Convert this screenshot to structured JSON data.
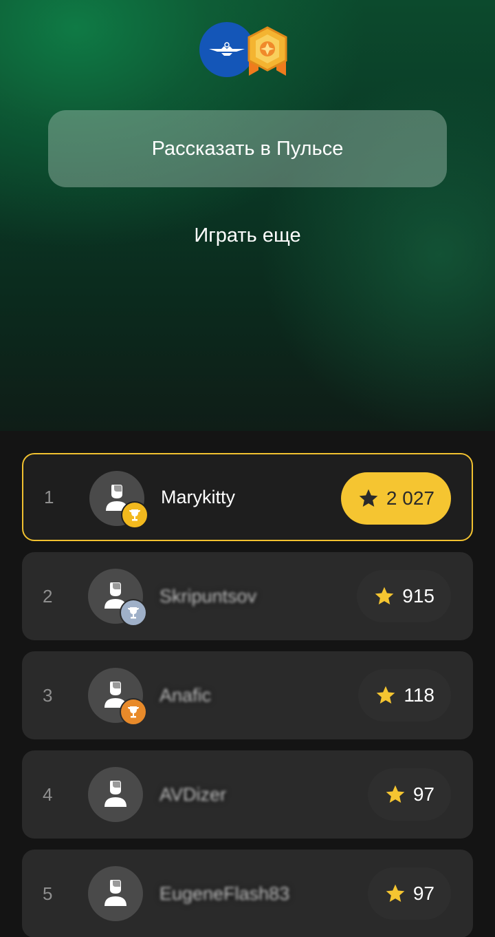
{
  "header": {
    "share_label": "Рассказать в Пульсе",
    "play_again_label": "Играть еще"
  },
  "colors": {
    "accent_gold": "#f5c531",
    "trophy_gold": "#f2b91e",
    "trophy_silver": "#9fb0c8",
    "trophy_bronze": "#e88a2a",
    "brand_blue": "#1456b8"
  },
  "leaderboard": [
    {
      "rank": "1",
      "name": "Marykitty",
      "score": "2 027",
      "trophy": "gold"
    },
    {
      "rank": "2",
      "name": "Skripuntsov",
      "score": "915",
      "trophy": "silver"
    },
    {
      "rank": "3",
      "name": "Anafic",
      "score": "118",
      "trophy": "bronze"
    },
    {
      "rank": "4",
      "name": "AVDizer",
      "score": "97",
      "trophy": ""
    },
    {
      "rank": "5",
      "name": "EugeneFlash83",
      "score": "97",
      "trophy": ""
    }
  ]
}
